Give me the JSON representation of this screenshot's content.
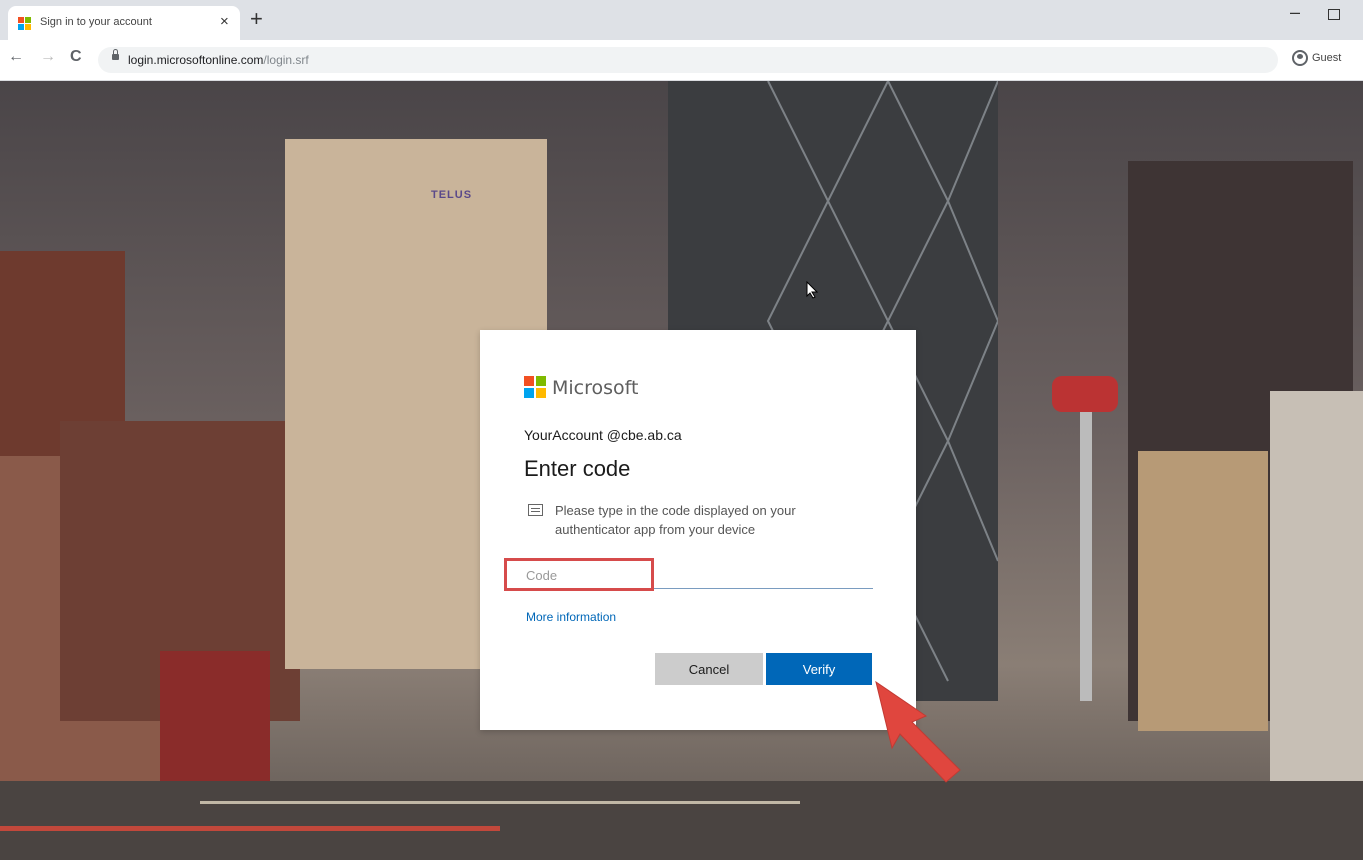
{
  "browser": {
    "tab_title": "Sign in to your account",
    "tab_close": "×",
    "new_tab": "+",
    "window_minimize": "–",
    "nav_back": "←",
    "nav_forward": "→",
    "nav_reload": "C",
    "url_host": "login.microsoftonline.com",
    "url_path": "/login.srf",
    "profile_label": "Guest"
  },
  "dialog": {
    "brand": "Microsoft",
    "account": "YourAccount @cbe.ab.ca",
    "heading": "Enter code",
    "instruction": "Please type in the code displayed on your authenticator app from your device",
    "code_placeholder": "Code",
    "code_value": "",
    "more_info": "More information",
    "cancel": "Cancel",
    "verify": "Verify"
  },
  "background": {
    "sign_text": "TELUS"
  },
  "colors": {
    "ms_red": "#f25022",
    "ms_green": "#7fba00",
    "ms_blue": "#00a4ef",
    "ms_yellow": "#ffb900",
    "primary": "#0067b8",
    "highlight": "#d64b4b"
  },
  "icons": [
    "microsoft-logo-icon",
    "lock-icon",
    "profile-icon",
    "sms-message-icon",
    "red-arrow-icon",
    "mouse-cursor-icon"
  ]
}
